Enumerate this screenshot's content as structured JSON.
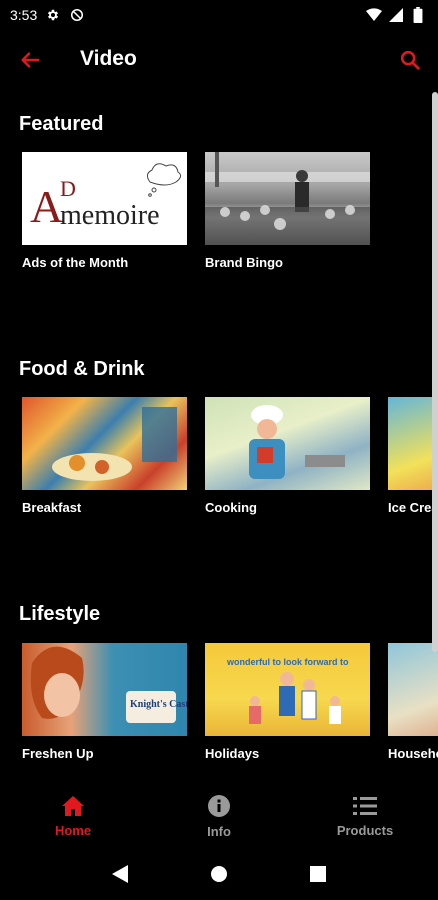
{
  "status_bar": {
    "time": "3:53"
  },
  "app_bar": {
    "title": "Video"
  },
  "sections": [
    {
      "title": "Featured",
      "items": [
        {
          "label": "Ads of the Month"
        },
        {
          "label": "Brand Bingo"
        }
      ]
    },
    {
      "title": "Food & Drink",
      "items": [
        {
          "label": "Breakfast"
        },
        {
          "label": "Cooking"
        },
        {
          "label": "Ice Cream"
        }
      ]
    },
    {
      "title": "Lifestyle",
      "items": [
        {
          "label": "Freshen Up"
        },
        {
          "label": "Holidays"
        },
        {
          "label": "Household"
        }
      ]
    }
  ],
  "thumbnails": {
    "ad_memoire_text_1": "AD",
    "ad_memoire_text_2": "memoire",
    "freshen_text": "Knight's Castile",
    "holidays_text": "wonderful to look forward to"
  },
  "bottom_nav": {
    "home": "Home",
    "info": "Info",
    "products": "Products"
  },
  "colors": {
    "accent": "#e0191f",
    "inactive": "#9a9a9a",
    "background": "#000000"
  }
}
